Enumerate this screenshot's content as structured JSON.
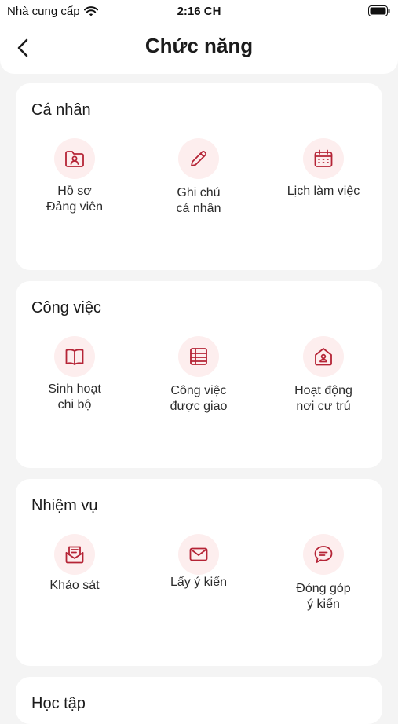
{
  "status_bar": {
    "carrier": "Nhà cung cấp",
    "time": "2:16 CH"
  },
  "header": {
    "title": "Chức năng"
  },
  "colors": {
    "accent": "#b52436",
    "icon_bg": "#fdeeee",
    "card_bg": "#ffffff",
    "page_bg": "#f4f4f4"
  },
  "sections": [
    {
      "title": "Cá nhân",
      "items": [
        {
          "label": "Hồ sơ\nĐảng viên",
          "icon": "folder-user-icon"
        },
        {
          "label": "Ghi chú\ncá nhân",
          "icon": "pencil-icon"
        },
        {
          "label": "Lịch làm việc",
          "icon": "calendar-icon"
        }
      ]
    },
    {
      "title": "Công việc",
      "items": [
        {
          "label": "Sinh hoạt\nchi bộ",
          "icon": "book-icon"
        },
        {
          "label": "Công việc\nđược giao",
          "icon": "table-icon"
        },
        {
          "label": "Hoạt động\nnơi cư trú",
          "icon": "home-user-icon"
        }
      ]
    },
    {
      "title": "Nhiệm vụ",
      "items": [
        {
          "label": "Khảo sát",
          "icon": "mail-open-icon"
        },
        {
          "label": "Lấy ý kiến",
          "icon": "envelope-icon"
        },
        {
          "label": "Đóng góp\ný kiến",
          "icon": "chat-icon"
        }
      ]
    },
    {
      "title": "Học tập",
      "items": []
    }
  ]
}
